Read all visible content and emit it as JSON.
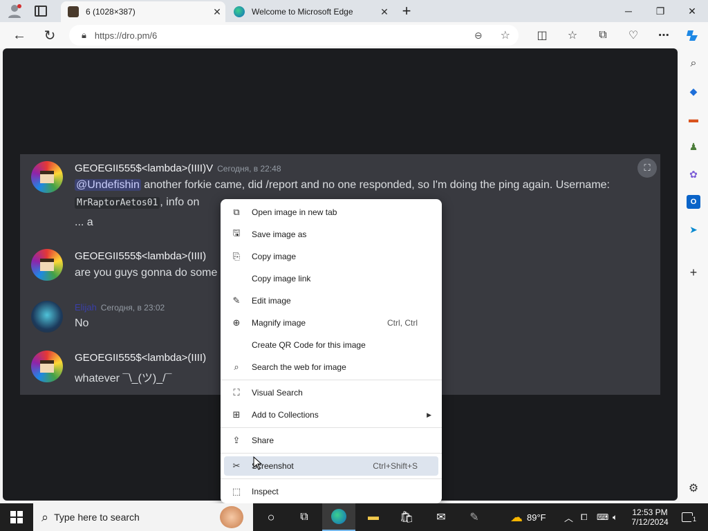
{
  "browser": {
    "tabs": [
      {
        "title": "6 (1028×387)",
        "active": true
      },
      {
        "title": "Welcome to Microsoft Edge",
        "active": false
      }
    ],
    "url": "https://dro.pm/6",
    "window_controls": {
      "minimize": "─",
      "restore": "❐",
      "close": "✕"
    }
  },
  "chat": {
    "messages": [
      {
        "username": "GEOEGII555$<lambda>(IIII)V",
        "timestamp": "Сегодня, в 22:48",
        "mention": "@Undefishin",
        "line1": " another forkie came, did /report and no one responded, so I'm doing the ping again. Username:",
        "code": "MrRaptorAetos01",
        "line2_suffix": ", info on",
        "line3": "... a"
      },
      {
        "username": "GEOEGII555$<lambda>(IIII)",
        "text": "are you guys gonna do some"
      },
      {
        "username": "Elijah",
        "timestamp": "Сегодня, в 23:02",
        "text": "No"
      },
      {
        "username": "GEOEGII555$<lambda>(IIII)",
        "text": "whatever ¯\\_(ツ)_/¯"
      }
    ]
  },
  "context_menu": {
    "items": [
      {
        "label": "Open image in new tab",
        "icon": "open-new-tab-icon",
        "glyph": "⧉"
      },
      {
        "label": "Save image as",
        "icon": "save-image-icon",
        "glyph": "🖫"
      },
      {
        "label": "Copy image",
        "icon": "copy-image-icon",
        "glyph": "⎘"
      },
      {
        "label": "Copy image link",
        "icon": "",
        "glyph": ""
      },
      {
        "label": "Edit image",
        "icon": "edit-image-icon",
        "glyph": "✎"
      },
      {
        "label": "Magnify image",
        "icon": "magnify-icon",
        "glyph": "⊕",
        "shortcut": "Ctrl, Ctrl"
      },
      {
        "label": "Create QR Code for this image",
        "icon": "",
        "glyph": ""
      },
      {
        "label": "Search the web for image",
        "icon": "search-web-icon",
        "glyph": "⌕"
      },
      {
        "label": "Visual Search",
        "icon": "visual-search-icon",
        "glyph": "⛶"
      },
      {
        "label": "Add to Collections",
        "icon": "collections-icon",
        "glyph": "⊞",
        "submenu": true
      },
      {
        "label": "Share",
        "icon": "share-icon",
        "glyph": "⇪"
      },
      {
        "label": "Screenshot",
        "icon": "screenshot-icon",
        "glyph": "✂",
        "shortcut": "Ctrl+Shift+S",
        "highlighted": true
      },
      {
        "label": "Inspect",
        "icon": "inspect-icon",
        "glyph": "⬚"
      }
    ]
  },
  "taskbar": {
    "search_placeholder": "Type here to search",
    "weather": "89°F",
    "time": "12:53 PM",
    "date": "7/12/2024",
    "notifications": "1"
  },
  "colors": {
    "page_bg": "#1b1c1f",
    "chat_bg": "#393a40",
    "mention_bg": "#3c4270",
    "menu_highlight": "#dde4ee"
  }
}
